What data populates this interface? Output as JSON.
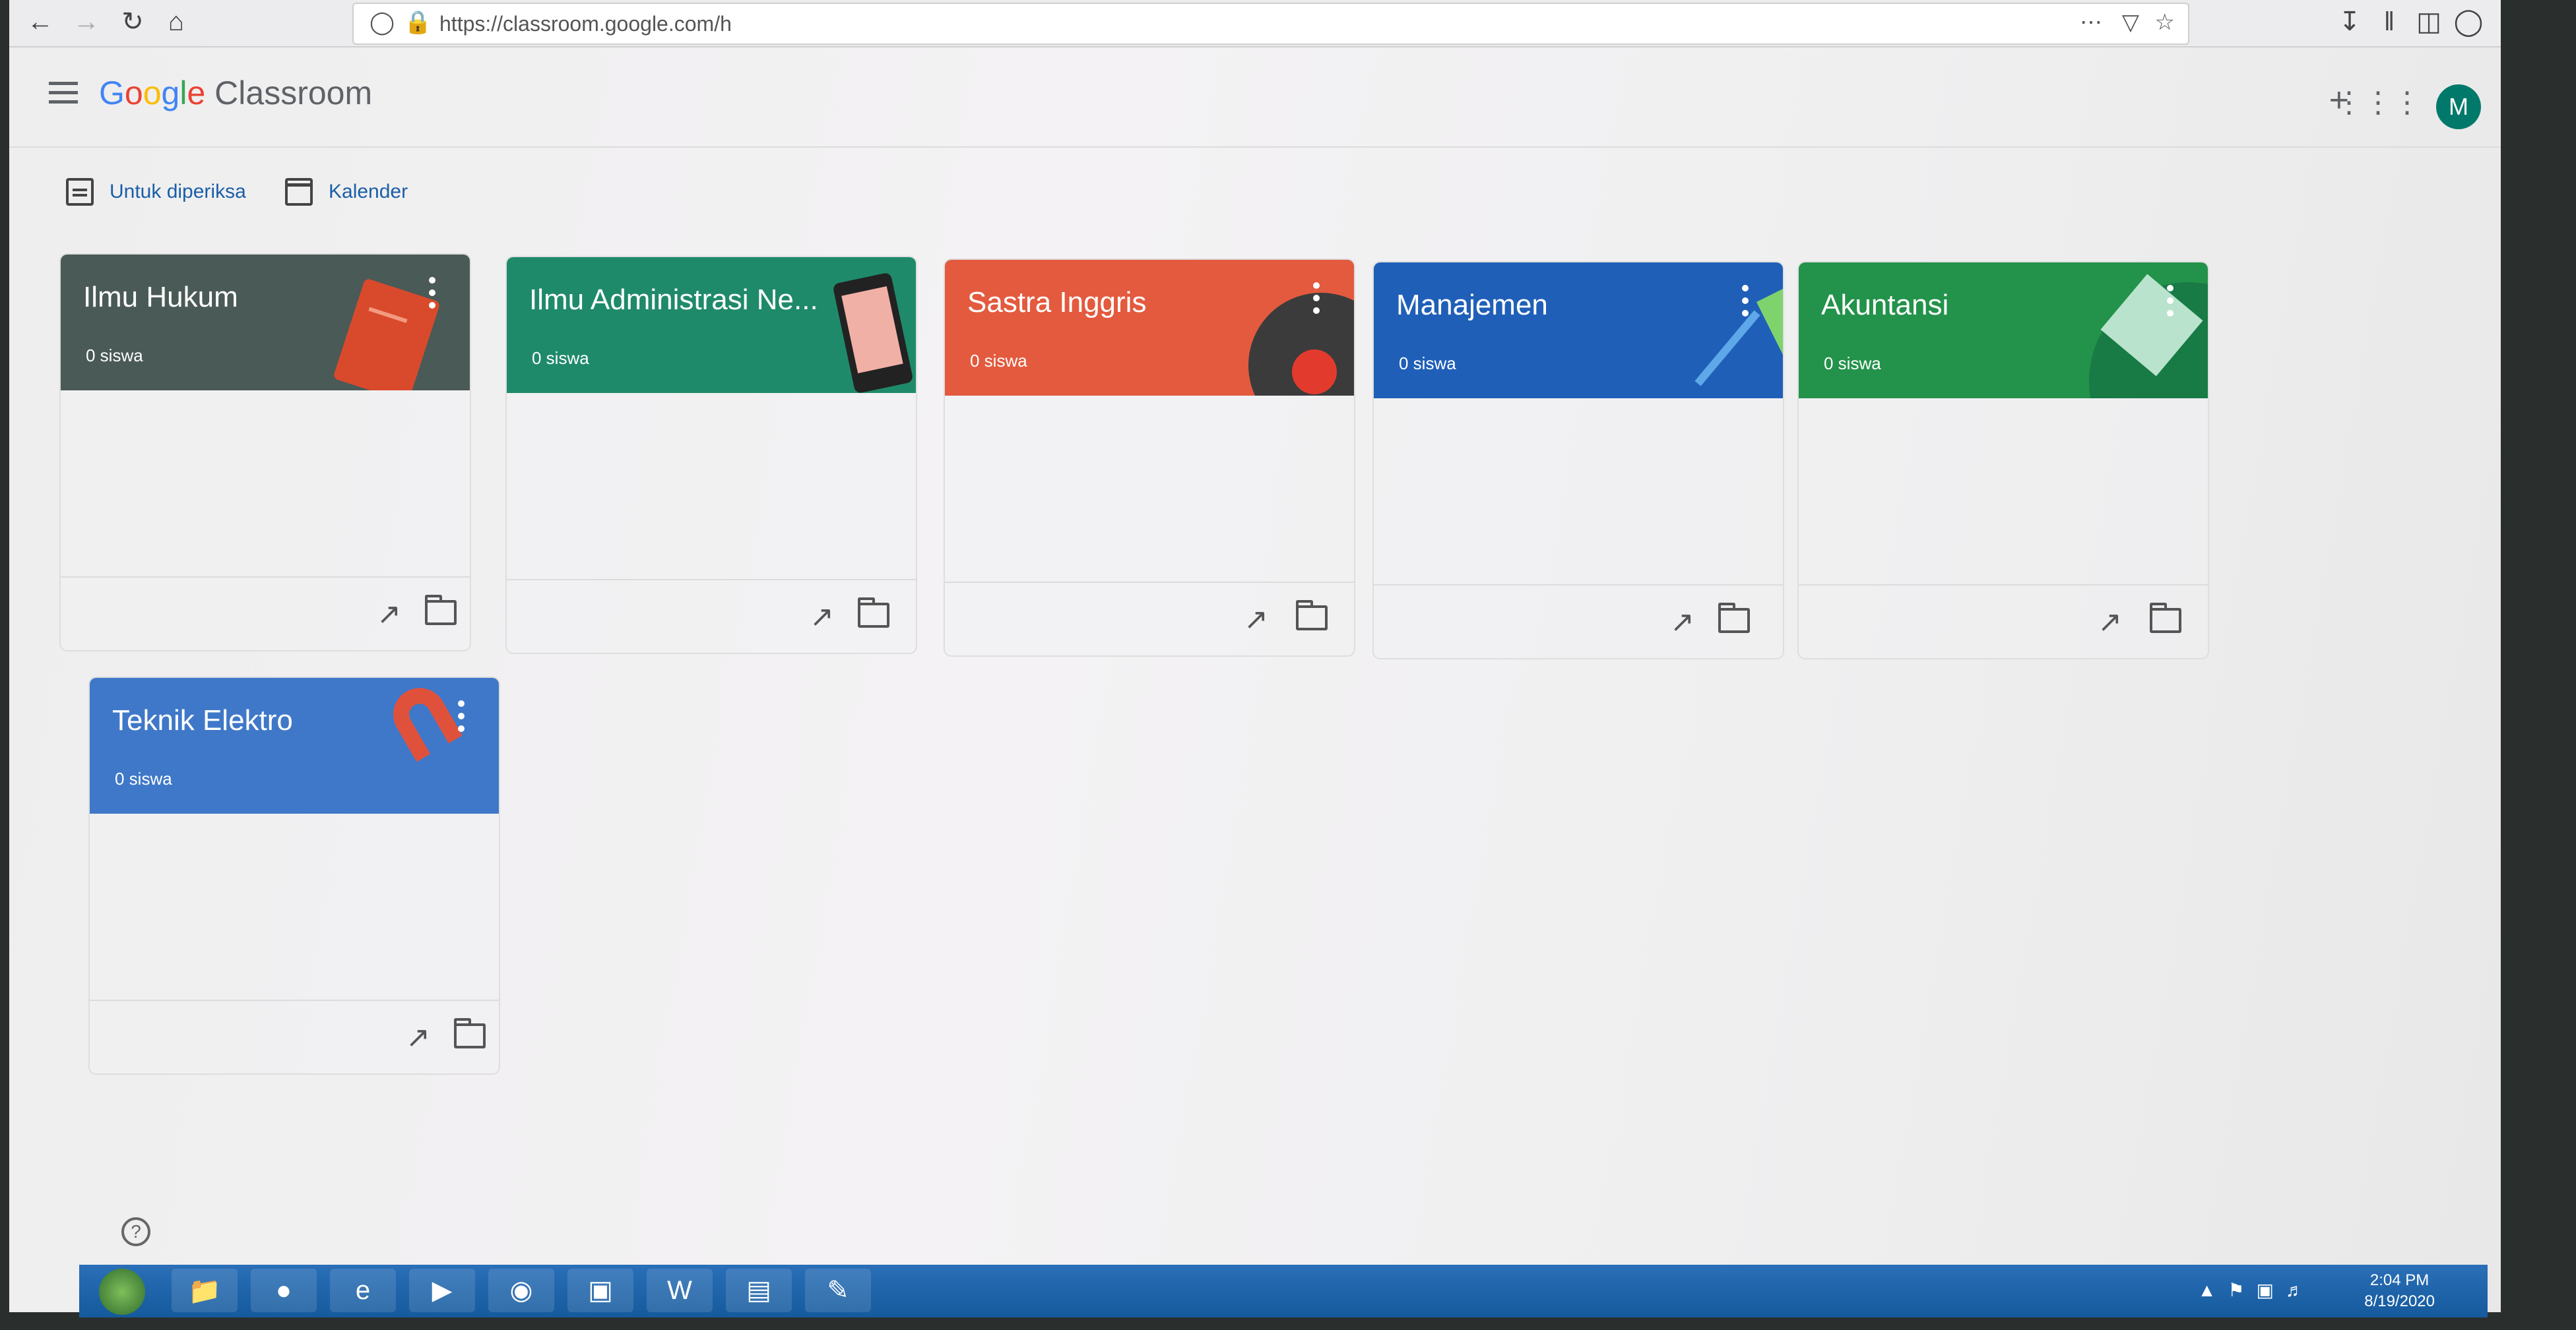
{
  "browser": {
    "url": "https://classroom.google.com/h"
  },
  "header": {
    "logo_google": [
      "G",
      "o",
      "o",
      "g",
      "l",
      "e"
    ],
    "logo_product": "Classroom",
    "avatar_letter": "M"
  },
  "subnav": {
    "to_review": "Untuk diperiksa",
    "calendar": "Kalender"
  },
  "classes": [
    {
      "title": "Ilmu Hukum",
      "students": "0 siswa",
      "color": "#4a5a56"
    },
    {
      "title": "Ilmu Administrasi Ne...",
      "students": "0 siswa",
      "color": "#1f8a6a"
    },
    {
      "title": "Sastra Inggris",
      "students": "0 siswa",
      "color": "#e35a3e"
    },
    {
      "title": "Manajemen",
      "students": "0 siswa",
      "color": "#1f5fb8"
    },
    {
      "title": "Akuntansi",
      "students": "0 siswa",
      "color": "#23924a"
    },
    {
      "title": "Teknik Elektro",
      "students": "0 siswa",
      "color": "#3f78c8"
    }
  ],
  "taskbar": {
    "time": "2:04 PM",
    "date": "8/19/2020"
  }
}
